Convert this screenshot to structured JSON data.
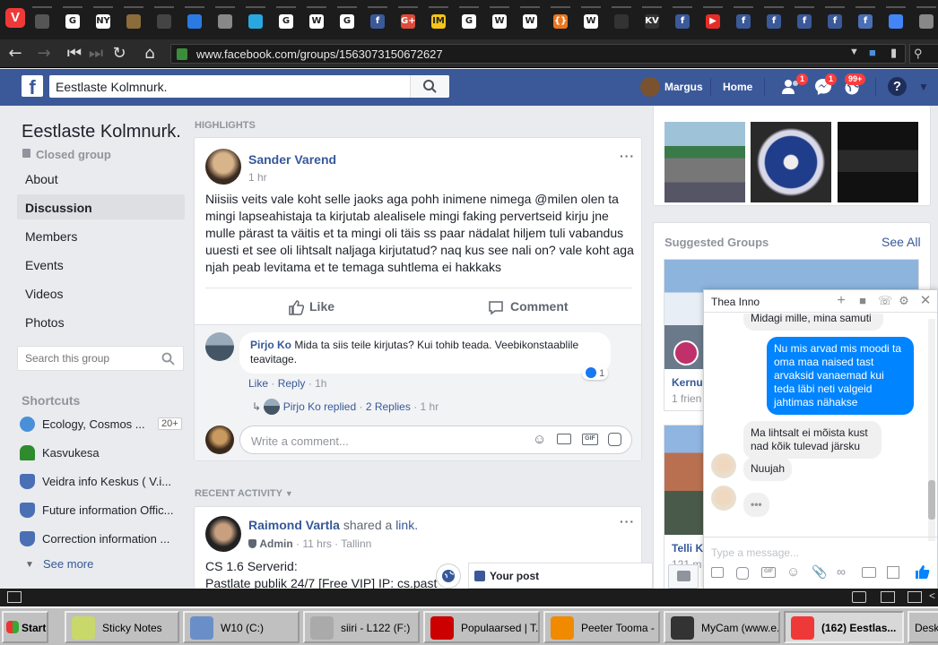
{
  "browser": {
    "url": "www.facebook.com/groups/1563073150672627",
    "tabs": [
      {
        "icon": "vivaldi-tab-icon",
        "color": "#555"
      },
      {
        "icon": "google-tab-icon",
        "color": "#ffffff"
      },
      {
        "icon": "nyfa-tab-icon",
        "color": "#ffffff"
      },
      {
        "icon": "heart-tab-icon",
        "color": "#8a6d3b"
      },
      {
        "icon": "zebra-tab-icon",
        "color": "#444"
      },
      {
        "icon": "gear-tab-icon",
        "color": "#2a7ae2"
      },
      {
        "icon": "globe-tab-icon",
        "color": "#888"
      },
      {
        "icon": "stats-tab-icon",
        "color": "#29a8e0"
      },
      {
        "icon": "google-tab-icon",
        "color": "#ffffff"
      },
      {
        "icon": "wikipedia-tab-icon",
        "color": "#ffffff"
      },
      {
        "icon": "google-tab-icon",
        "color": "#ffffff"
      },
      {
        "icon": "facebook-tab-icon",
        "color": "#3b5998"
      },
      {
        "icon": "google-plus-tab-icon",
        "color": "#dd4b39"
      },
      {
        "icon": "imdb-tab-icon",
        "color": "#f5c518"
      },
      {
        "icon": "google-tab-icon",
        "color": "#ffffff"
      },
      {
        "icon": "wikipedia-tab-icon",
        "color": "#ffffff"
      },
      {
        "icon": "wikipedia-tab-icon",
        "color": "#ffffff"
      },
      {
        "icon": "code-tab-icon",
        "color": "#e87722"
      },
      {
        "icon": "wikipedia-tab-icon",
        "color": "#ffffff"
      },
      {
        "icon": "dots-tab-icon",
        "color": "#333"
      },
      {
        "icon": "kv-tab-icon",
        "color": "#333"
      },
      {
        "icon": "facebook-tab-icon",
        "color": "#3b5998"
      },
      {
        "icon": "youtube-tab-icon",
        "color": "#e52d27"
      },
      {
        "icon": "facebook-tab-icon",
        "color": "#3b5998"
      },
      {
        "icon": "facebook-tab-icon",
        "color": "#3b5998"
      },
      {
        "icon": "facebook-tab-icon",
        "color": "#3b5998"
      },
      {
        "icon": "facebook-tab-icon",
        "color": "#3b5998"
      },
      {
        "icon": "facebook-tab-icon",
        "color": "#4a6fb5"
      },
      {
        "icon": "translate-tab-icon",
        "color": "#4285f4"
      },
      {
        "icon": "globe-tab-icon",
        "color": "#888"
      }
    ],
    "tab_letters": {
      "nyfa": "NY FA",
      "kv": "KV",
      "w": "W",
      "g": "G"
    }
  },
  "fb": {
    "search_value": "Eestlaste Kolmnurk.",
    "user": "Margus",
    "home": "Home",
    "badges": {
      "friends": "1",
      "messages": "1",
      "notifications": "99+"
    }
  },
  "group": {
    "name": "Eestlaste Kolmnurk.",
    "type": "Closed group",
    "nav": [
      "About",
      "Discussion",
      "Members",
      "Events",
      "Videos",
      "Photos"
    ],
    "search_placeholder": "Search this group",
    "shortcuts_title": "Shortcuts",
    "shortcuts": [
      {
        "label": "Ecology, Cosmos ...",
        "color": "#4a90d9"
      },
      {
        "label": "Kasvukesa",
        "color": "#2e8b2e"
      },
      {
        "label": "Veidra info Keskus ( V.i...",
        "color": "#4a6fb5"
      },
      {
        "label": "Future information Offic...",
        "color": "#4a6fb5"
      },
      {
        "label": "Correction information ...",
        "color": "#4a6fb5"
      }
    ],
    "shortcut_count": "20+",
    "see_more": "See more"
  },
  "highlights": {
    "header": "HIGHLIGHTS",
    "post": {
      "author": "Sander Varend",
      "time": "1 hr",
      "text": "Niisiis veits vale koht selle jaoks aga pohh inimene nimega @milen olen ta mingi lapseahistaja ta kirjutab alealisele mingi faking pervertseid kirju jne mulle pärast ta väitis et ta mingi oli täis ss paar nädalat hiljem tuli vabandus uuesti et see oli lihtsalt naljaga kirjutatud? naq kus see nali on? vale koht aga njah peab levitama et te temaga suhtlema ei hakkaks",
      "like": "Like",
      "comment": "Comment"
    },
    "comment": {
      "author": "Pirjo Ko",
      "text": "Mida ta siis teile kirjutas? Kui tohib teada. Veebikonstaablile teavitage.",
      "like": "Like",
      "reply": "Reply",
      "time": "1h",
      "reactions": "1",
      "replies_author": "Pirjo Ko replied",
      "replies_count": "2 Replies",
      "replies_time": "1 hr"
    },
    "write_placeholder": "Write a comment..."
  },
  "recent": {
    "header": "RECENT ACTIVITY",
    "post": {
      "author": "Raimond Vartla",
      "action_1": "shared a",
      "action_link": "link.",
      "role": "Admin",
      "time": "11 hrs",
      "place": "Tallinn",
      "line1": "CS 1.6 Serverid:",
      "line2": "Pastlate publik 24/7 [Free VIP] IP: cs.past"
    }
  },
  "right": {
    "suggested_title": "Suggested Groups",
    "see_all": "See All",
    "group1_name": "Kernu",
    "group1_members": "1 frien",
    "group2_name": "Telli Ka",
    "group2_members": "121 m"
  },
  "chat": {
    "name": "Thea Inno",
    "partial_top": "Midagi mille, mina samuti",
    "me_msg": "Nu mis arvad mis moodi ta oma maa naised tast arvaksid vanaemad kui teda läbi neti valgeid jahtimas nähakse",
    "them_msg1": "Ma lihtsalt ei mõista kust nad kõik tulevad järsku",
    "them_msg2": "Nuujah",
    "typing": "•••",
    "input_placeholder": "Type a message..."
  },
  "your_post": "Your post",
  "taskbar": {
    "start": "Start",
    "items": [
      {
        "label": "Sticky Notes",
        "color": "#c8d86a"
      },
      {
        "label": "W10 (C:)",
        "color": "#6a8fc8"
      },
      {
        "label": "siiri - L122 (F:)",
        "color": "#aaa"
      },
      {
        "label": "Populaarsed | T...",
        "color": "#cc0000"
      },
      {
        "label": "Peeter Tooma - ...",
        "color": "#f08a00"
      },
      {
        "label": "MyCam (www.e...",
        "color": "#333"
      },
      {
        "label": "(162) Eestlas...",
        "color": "#ef3939"
      },
      {
        "label": "Desk",
        "color": "#c0c0c0"
      }
    ]
  }
}
